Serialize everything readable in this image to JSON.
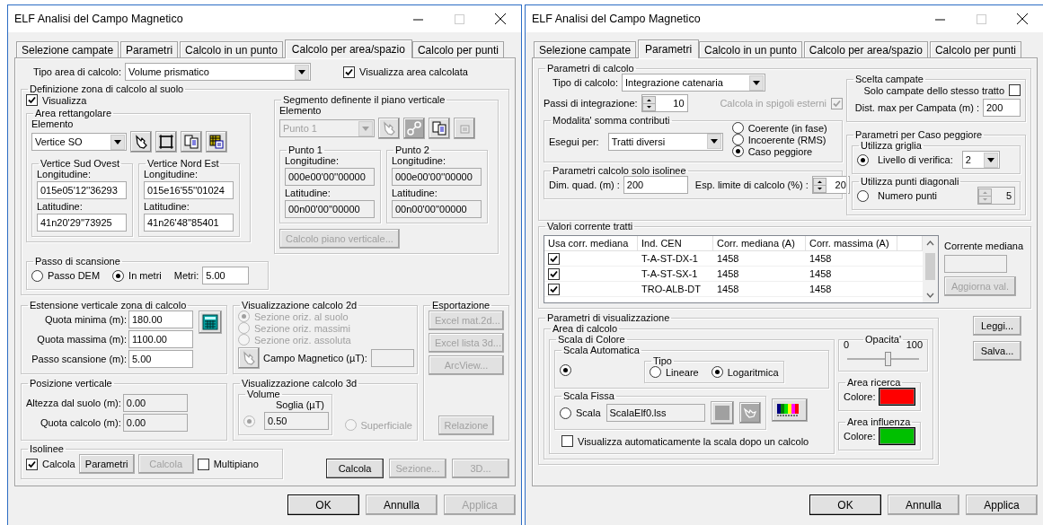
{
  "windows": [
    {
      "title": "ELF Analisi del Campo Magnetico",
      "tabs": [
        {
          "label": "Selezione campate",
          "selected": false
        },
        {
          "label": "Parametri",
          "selected": false
        },
        {
          "label": "Calcolo in un punto",
          "selected": false
        },
        {
          "label": "Calcolo per area/spazio",
          "selected": true
        },
        {
          "label": "Calcolo per punti",
          "selected": false
        }
      ],
      "page": {
        "area_type": {
          "label": "Tipo area di calcolo:",
          "value": "Volume prismatico"
        },
        "show_area": {
          "label": "Visualizza area calcolata",
          "checked": true
        },
        "ground_zone": {
          "title": "Definizione zona di calcolo al suolo",
          "show": {
            "label": "Visualizza",
            "checked": true
          },
          "rect_area": {
            "title": "Area rettangolare",
            "element_label": "Elemento",
            "element": {
              "value": "Vertice SO",
              "disabled": false
            },
            "vertices": [
              {
                "title": "Vertice Sud Ovest",
                "lon_label": "Longitudine:",
                "lon": "015e05'12''36293",
                "lat_label": "Latitudine:",
                "lat": "41n20'29''73925"
              },
              {
                "title": "Vertice Nord Est",
                "lon_label": "Longitudine:",
                "lon": "015e16'55''01024",
                "lat_label": "Latitudine:",
                "lat": "41n26'48''85401"
              }
            ]
          },
          "segment": {
            "title": "Segmento definente il piano verticale",
            "element_label": "Elemento",
            "element": {
              "value": "Punto 1",
              "disabled": true
            },
            "points": [
              {
                "title": "Punto 1",
                "lon_label": "Longitudine:",
                "lon": "000e00'00''00000",
                "lat_label": "Latitudine:",
                "lat": "00n00'00''00000"
              },
              {
                "title": "Punto 2",
                "lon_label": "Longitudine:",
                "lon": "000e00'00''00000",
                "lat_label": "Latitudine:",
                "lat": "00n00'00''00000"
              }
            ],
            "button": {
              "label": "Calcolo piano verticale...",
              "disabled": true
            }
          },
          "scan_step": {
            "title": "Passo di scansione",
            "options": [
              {
                "label": "Passo DEM",
                "selected": false
              },
              {
                "label": "In metri",
                "selected": true
              }
            ],
            "meters_label": "Metri:",
            "meters": "5.00"
          }
        },
        "vertical_extent": {
          "title": "Estensione verticale zona di calcolo",
          "fields": [
            {
              "label": "Quota minima (m):",
              "value": "180.00"
            },
            {
              "label": "Quota massima (m):",
              "value": "1100.00"
            },
            {
              "label": "Passo scansione (m):",
              "value": "5.00"
            }
          ]
        },
        "vertical_position": {
          "title": "Posizione verticale",
          "fields": [
            {
              "label": "Altezza dal suolo (m):",
              "value": "0.00"
            },
            {
              "label": "Quota calcolo (m):",
              "value": "0.00"
            }
          ]
        },
        "view_2d": {
          "title": "Visualizzazione calcolo 2d",
          "disabled": true,
          "options": [
            {
              "label": "Sezione oriz. al suolo",
              "selected": true
            },
            {
              "label": "Sezione oriz. massimi",
              "selected": false
            },
            {
              "label": "Sezione oriz. assoluta",
              "selected": false
            }
          ],
          "field_label": "Campo Magnetico (µT):"
        },
        "view_3d": {
          "title": "Visualizzazione calcolo 3d",
          "disabled": true,
          "volume": {
            "title": "Volume",
            "threshold_label": "Soglia (µT)",
            "threshold": "0.50",
            "selected": true
          },
          "surface": {
            "label": "Superficiale",
            "selected": false
          }
        },
        "export": {
          "title": "Esportazione",
          "buttons": [
            {
              "label": "Excel mat.2d...",
              "disabled": true
            },
            {
              "label": "Excel lista 3d...",
              "disabled": true
            },
            {
              "label": "ArcView...",
              "disabled": true
            }
          ],
          "report": {
            "label": "Relazione",
            "disabled": true
          }
        },
        "isolines": {
          "title": "Isolinee",
          "calc": {
            "label": "Calcola",
            "checked": true
          },
          "buttons": [
            {
              "label": "Parametri",
              "disabled": false
            },
            {
              "label": "Calcola",
              "disabled": true
            }
          ],
          "multi": {
            "label": "Multipiano",
            "checked": false
          }
        },
        "actions": [
          {
            "label": "Calcola",
            "disabled": false
          },
          {
            "label": "Sezione...",
            "disabled": true
          },
          {
            "label": "3D...",
            "disabled": true
          }
        ]
      },
      "footer": [
        {
          "label": "OK",
          "default": true,
          "disabled": false
        },
        {
          "label": "Annulla",
          "default": false,
          "disabled": false
        },
        {
          "label": "Applica",
          "default": false,
          "disabled": true
        }
      ]
    },
    {
      "title": "ELF Analisi del Campo Magnetico",
      "tabs": [
        {
          "label": "Selezione campate",
          "selected": false
        },
        {
          "label": "Parametri",
          "selected": true
        },
        {
          "label": "Calcolo in un punto",
          "selected": false
        },
        {
          "label": "Calcolo per area/spazio",
          "selected": false
        },
        {
          "label": "Calcolo per punti",
          "selected": false
        }
      ],
      "page": {
        "calc_params": {
          "title": "Parametri di calcolo",
          "calc_type": {
            "label": "Tipo di calcolo:",
            "value": "Integrazione catenaria"
          },
          "steps": {
            "label": "Passi di integrazione:",
            "value": "10"
          },
          "edges": {
            "label": "Calcola in spigoli esterni",
            "checked": true,
            "disabled": true
          },
          "sum_mode": {
            "title": "Modalita' somma contributi",
            "run_for": {
              "label": "Esegui per:",
              "value": "Tratti diversi"
            },
            "options": [
              {
                "label": "Coerente (in fase)",
                "selected": false
              },
              {
                "label": "Incoerente (RMS)",
                "selected": false
              },
              {
                "label": "Caso peggiore",
                "selected": true
              }
            ]
          },
          "isoline_params": {
            "title": "Parametri calcolo solo isolinee",
            "dim": {
              "label": "Dim. quad. (m) :",
              "value": "200"
            },
            "limit": {
              "label": "Esp. limite di calcolo (%) :",
              "value": "20"
            }
          },
          "span_choice": {
            "title": "Scelta campate",
            "same_section": {
              "label": "Solo campate dello stesso tratto",
              "checked": false
            },
            "max_dist": {
              "label": "Dist. max per Campata (m) :",
              "value": "200"
            }
          },
          "worst_case": {
            "title": "Parametri per Caso peggiore",
            "grid": {
              "title": "Utilizza griglia",
              "selected": true,
              "label": "Livello di verifica:",
              "value": "2"
            },
            "diagonal": {
              "title": "Utilizza punti diagonali",
              "selected": false,
              "label": "Numero punti",
              "value": "5",
              "disabled": true
            }
          }
        },
        "currents": {
          "title": "Valori corrente tratti",
          "columns": [
            "Usa corr. mediana",
            "Ind. CEN",
            "Corr. mediana (A)",
            "Corr. massima (A)"
          ],
          "rows": [
            {
              "checked": true,
              "cells": [
                "",
                "T-A-ST-DX-1",
                "1458",
                "1458"
              ]
            },
            {
              "checked": true,
              "cells": [
                "",
                "T-A-ST-SX-1",
                "1458",
                "1458"
              ]
            },
            {
              "checked": true,
              "cells": [
                "",
                "TRO-ALB-DT",
                "1458",
                "1458"
              ]
            }
          ],
          "median_label": "Corrente mediana",
          "update": {
            "label": "Aggiorna val.",
            "disabled": true
          }
        },
        "visual": {
          "title": "Parametri di visualizzazione",
          "area": {
            "title": "Area di calcolo",
            "scale": {
              "title": "Scala di Colore",
              "auto": {
                "title": "Scala Automatica",
                "selected": true,
                "type": {
                  "title": "Tipo",
                  "options": [
                    {
                      "label": "Lineare",
                      "selected": false
                    },
                    {
                      "label": "Logaritmica",
                      "selected": true
                    }
                  ]
                }
              },
              "fixed": {
                "title": "Scala Fissa",
                "selected": false,
                "label": "Scala",
                "file": "ScalaElf0.lss"
              },
              "auto_show": {
                "label": "Visualizza automaticamente la scala dopo un calcolo",
                "checked": false
              }
            },
            "opacity": {
              "title": "Opacita'",
              "min": "0",
              "max": "100",
              "level": 0.58
            },
            "search_area": {
              "title": "Area ricerca",
              "label": "Colore:",
              "color": "#ff0000"
            },
            "influence_area": {
              "title": "Area influenza",
              "label": "Colore:",
              "color": "#00c000"
            }
          }
        },
        "side_buttons": [
          {
            "label": "Leggi...",
            "disabled": false
          },
          {
            "label": "Salva...",
            "disabled": false
          }
        ]
      },
      "footer": [
        {
          "label": "OK",
          "default": true,
          "disabled": false
        },
        {
          "label": "Annulla",
          "default": false,
          "disabled": false
        },
        {
          "label": "Applica",
          "default": false,
          "disabled": false
        }
      ]
    }
  ]
}
